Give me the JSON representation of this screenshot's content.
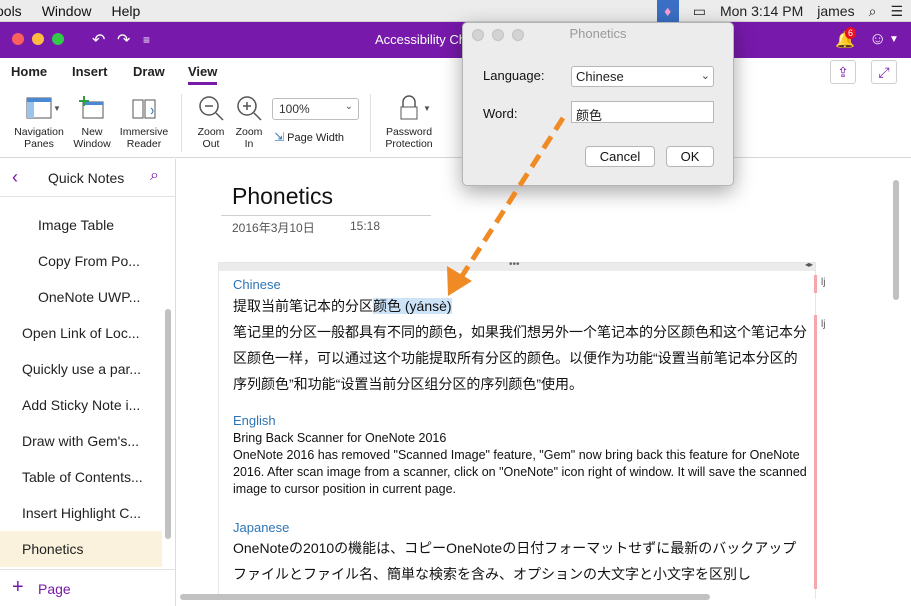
{
  "menubar": {
    "items": [
      "ools",
      "Window",
      "Help"
    ],
    "clock": "Mon 3:14 PM",
    "user": "james"
  },
  "titlebar": {
    "title": "Accessibility Checker",
    "notification_count": "6"
  },
  "ribbon": {
    "tabs": [
      "Home",
      "Insert",
      "Draw",
      "View"
    ],
    "active_tab": "View",
    "buttons": {
      "navigation_panes": "Navigation Panes",
      "new_window": "New Window",
      "immersive_reader": "Immersive Reader",
      "zoom_out": "Zoom Out",
      "zoom_in": "Zoom In",
      "zoom_value": "100%",
      "page_width": "Page Width",
      "password_protection": "Password Protection"
    }
  },
  "sidebar": {
    "title": "Quick Notes",
    "pages": [
      {
        "label": "Image Table",
        "indent": true
      },
      {
        "label": "Copy From Po...",
        "indent": true
      },
      {
        "label": "OneNote UWP...",
        "indent": true
      },
      {
        "label": "Open Link of Loc...",
        "indent": false
      },
      {
        "label": "Quickly use a par...",
        "indent": false
      },
      {
        "label": "Add Sticky Note i...",
        "indent": false
      },
      {
        "label": "Draw with Gem's...",
        "indent": false
      },
      {
        "label": "Table of Contents...",
        "indent": false
      },
      {
        "label": "Insert Highlight C...",
        "indent": false
      },
      {
        "label": "Phonetics",
        "indent": false,
        "selected": true
      }
    ],
    "add_page": "Page"
  },
  "page": {
    "title": "Phonetics",
    "date": "2016年3月10日",
    "time": "15:18",
    "chinese_heading": "Chinese",
    "chinese_line1_prefix": "提取当前笔记本的分区",
    "chinese_line1_highlight": "颜色 (yánsè)",
    "chinese_para": "笔记里的分区一般都具有不同的颜色，如果我们想另外一个笔记本的分区颜色和这个笔记本分区颜色一样，可以通过这个功能提取所有分区的颜色。以便作为功能“设置当前笔记本分区的序列颜色”和功能“设置当前分区组分区的序列颜色”使用。",
    "english_heading": "English",
    "english_title": "Bring Back Scanner  for OneNote 2016",
    "english_para": "OneNote 2016 has removed \"Scanned Image\" feature, \"Gem\" now bring back this feature for OneNote 2016. After scan image from a scanner, click on \"OneNote\" icon right of window. It will save the scanned image to cursor position in current page.",
    "japanese_heading": "Japanese",
    "japanese_para": "OneNoteの2010の機能は、コピーOneNoteの日付フォーマットせずに最新のバックアップファイルとファイル名、簡単な検索を含み、オプションの大文字と小文字を区別し",
    "side_tag": "lj"
  },
  "dialog": {
    "title": "Phonetics",
    "language_label": "Language:",
    "language_value": "Chinese",
    "word_label": "Word:",
    "word_value": "颜色",
    "cancel": "Cancel",
    "ok": "OK"
  },
  "colors": {
    "accent": "#7719aa",
    "link_blue": "#2e75b6",
    "highlight": "#cce3f8",
    "arrow": "#f08a24"
  }
}
